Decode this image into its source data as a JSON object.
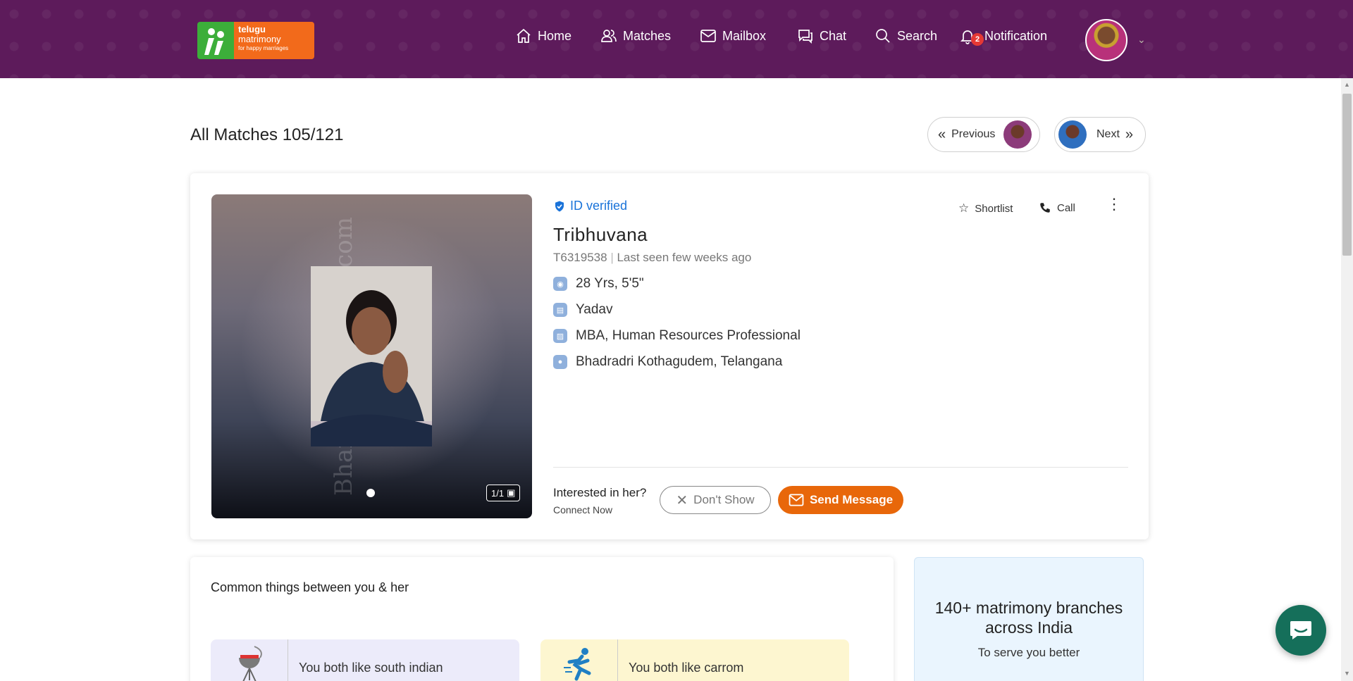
{
  "header": {
    "logo": {
      "line1": "telugu",
      "line2": "matrimony",
      "tagline": "for happy marriages"
    },
    "nav": [
      {
        "label": "Home",
        "icon": "home-icon"
      },
      {
        "label": "Matches",
        "icon": "users-icon"
      },
      {
        "label": "Mailbox",
        "icon": "mail-icon"
      },
      {
        "label": "Chat",
        "icon": "chat-icon"
      },
      {
        "label": "Search",
        "icon": "search-icon"
      },
      {
        "label": "Notification",
        "icon": "bell-icon",
        "badge": "2"
      }
    ],
    "colors": {
      "bar": "#5d1b5b"
    }
  },
  "page": {
    "title": "All Matches 105/121",
    "previous_label": "Previous",
    "next_label": "Next"
  },
  "profile": {
    "verified_label": "ID verified",
    "name": "Tribhuvana",
    "id": "T6319538",
    "last_seen": "Last seen few weeks ago",
    "facts": [
      {
        "icon": "age-height-icon",
        "text": "28 Yrs, 5'5\""
      },
      {
        "icon": "caste-icon",
        "text": "Yadav"
      },
      {
        "icon": "education-icon",
        "text": "MBA, Human Resources Professional"
      },
      {
        "icon": "location-icon",
        "text": "Bhadradri Kothagudem, Telangana"
      }
    ],
    "shortlist_label": "Shortlist",
    "call_label": "Call",
    "photo_count": "1/1",
    "watermark": "Bharat Matrimony.com",
    "interest_question": "Interested in her?",
    "interest_sub": "Connect Now",
    "dont_show_label": "Don't Show",
    "send_message_label": "Send Message",
    "colors": {
      "accent": "#e8670a",
      "verified": "#1a73d9"
    }
  },
  "common": {
    "title": "Common things between you & her",
    "items": [
      {
        "icon": "grill-icon",
        "text": "You both like south indian"
      },
      {
        "icon": "runner-icon",
        "text": "You both like carrom"
      }
    ]
  },
  "branches": {
    "title": "140+ matrimony branches across India",
    "subtitle": "To serve you better"
  }
}
